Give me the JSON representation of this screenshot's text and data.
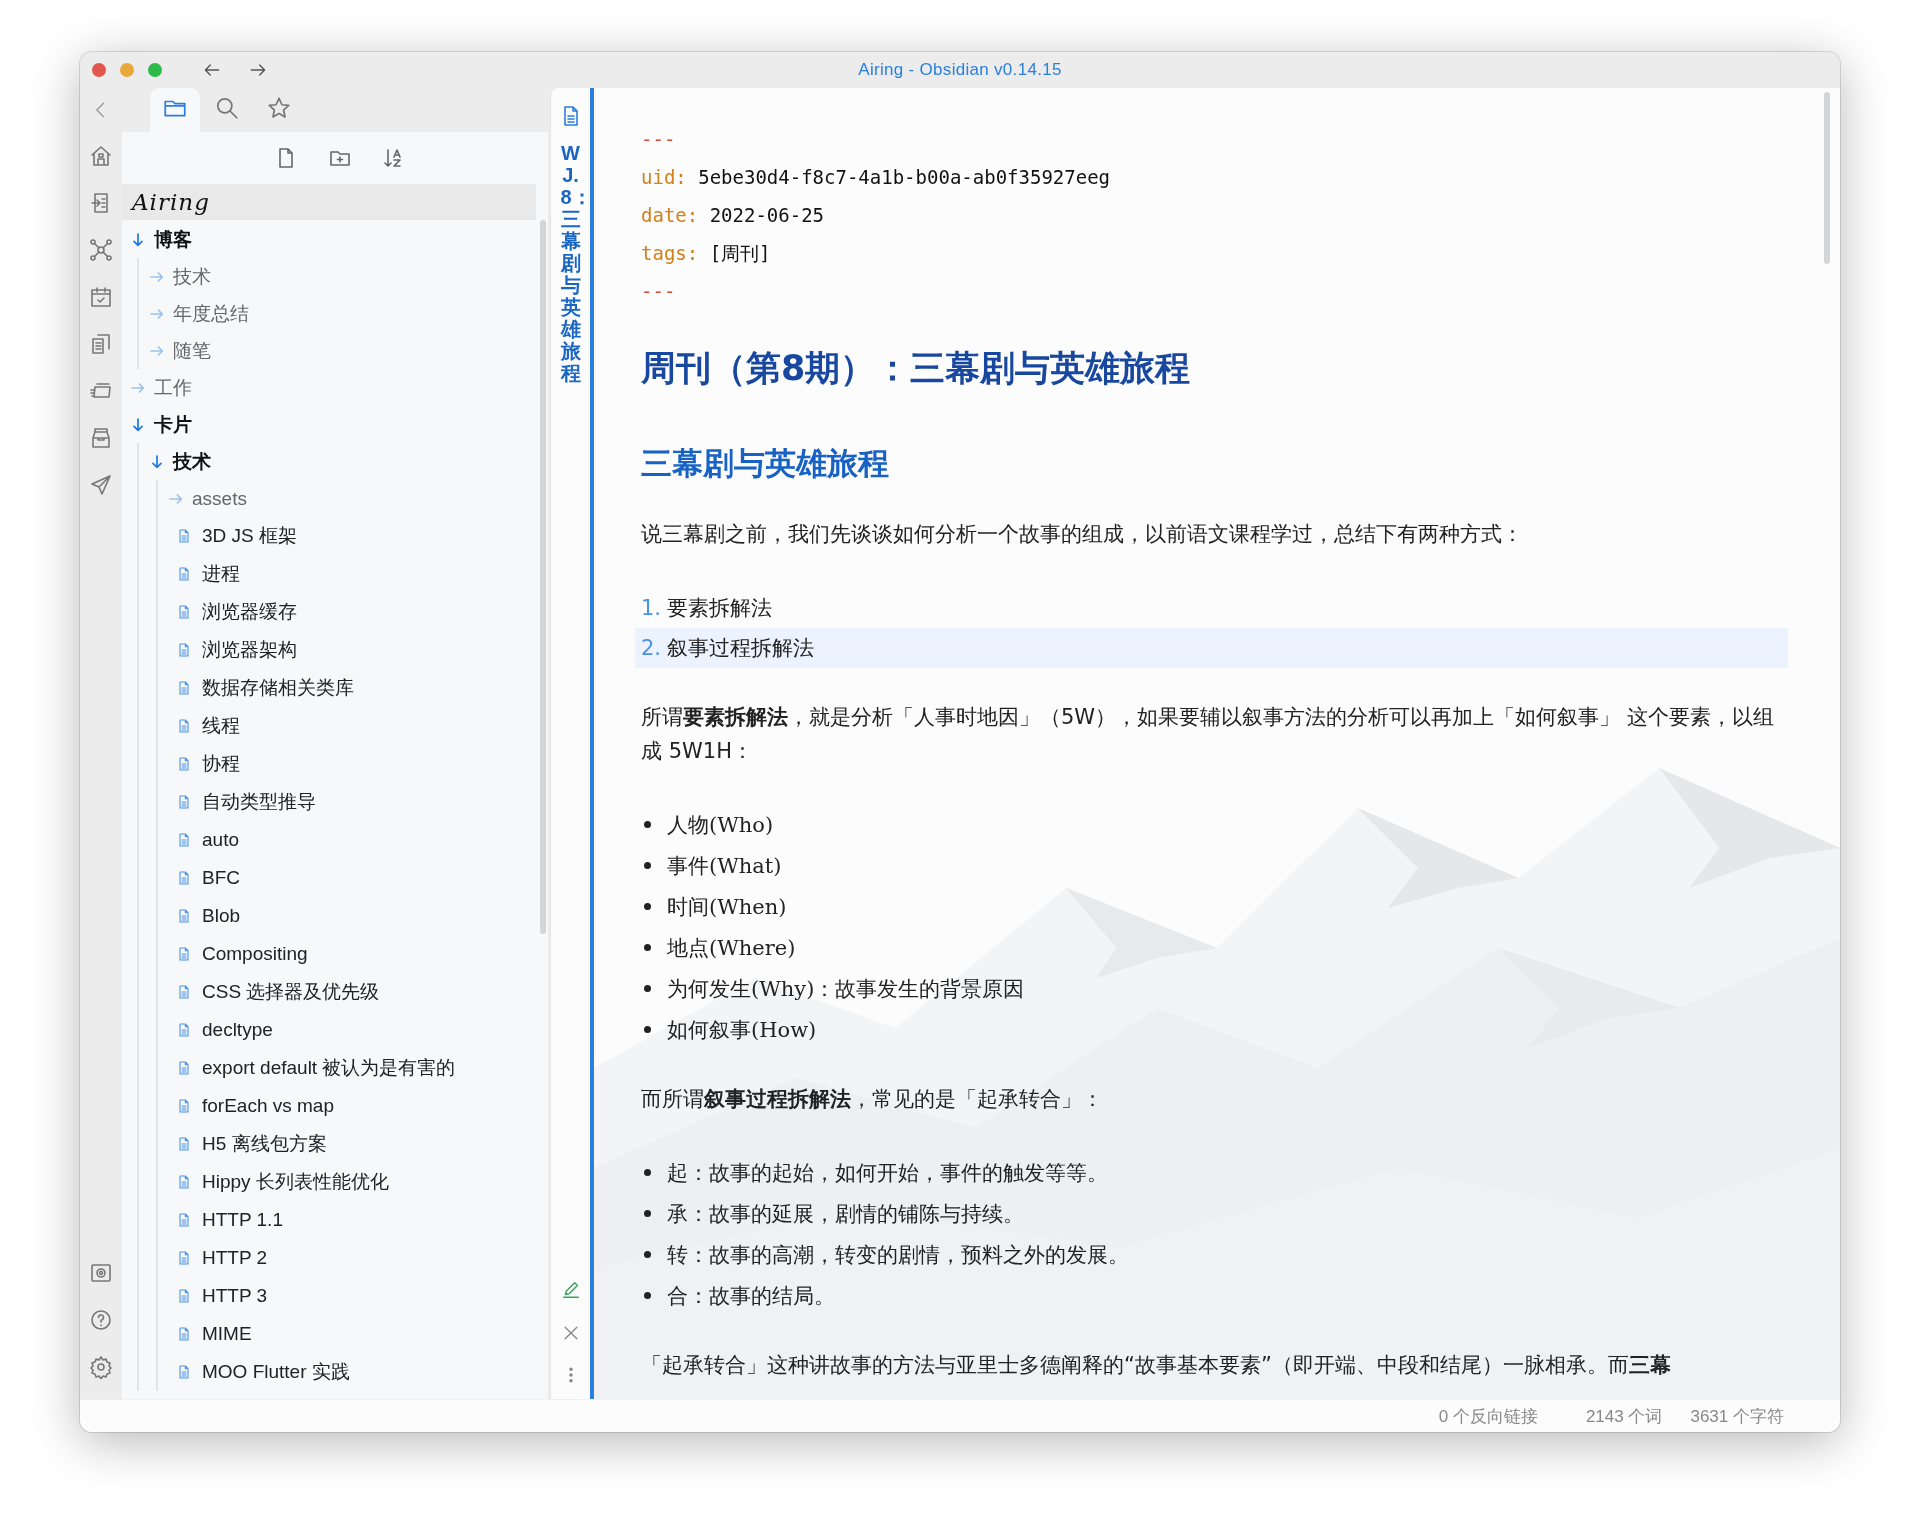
{
  "window": {
    "title": "Airing - Obsidian v0.14.15"
  },
  "sidebar_tabs": [
    {
      "selected": true
    },
    {
      "selected": false
    },
    {
      "selected": false
    }
  ],
  "vault_name": "Airing",
  "tree": [
    {
      "kind": "folder",
      "name": "博客",
      "expanded": true,
      "children": [
        {
          "kind": "folder",
          "name": "技术",
          "expanded": false
        },
        {
          "kind": "folder",
          "name": "年度总结",
          "expanded": false
        },
        {
          "kind": "folder",
          "name": "随笔",
          "expanded": false
        }
      ]
    },
    {
      "kind": "folder",
      "name": "工作",
      "expanded": false
    },
    {
      "kind": "folder",
      "name": "卡片",
      "expanded": true,
      "children": [
        {
          "kind": "folder",
          "name": "技术",
          "expanded": true,
          "children": [
            {
              "kind": "folder",
              "name": "assets",
              "expanded": false
            },
            {
              "kind": "file",
              "name": "3D JS 框架"
            },
            {
              "kind": "file",
              "name": "进程"
            },
            {
              "kind": "file",
              "name": "浏览器缓存"
            },
            {
              "kind": "file",
              "name": "浏览器架构"
            },
            {
              "kind": "file",
              "name": "数据存储相关类库"
            },
            {
              "kind": "file",
              "name": "线程"
            },
            {
              "kind": "file",
              "name": "协程"
            },
            {
              "kind": "file",
              "name": "自动类型推导"
            },
            {
              "kind": "file",
              "name": "auto"
            },
            {
              "kind": "file",
              "name": "BFC"
            },
            {
              "kind": "file",
              "name": "Blob"
            },
            {
              "kind": "file",
              "name": "Compositing"
            },
            {
              "kind": "file",
              "name": "CSS 选择器及优先级"
            },
            {
              "kind": "file",
              "name": "decltype"
            },
            {
              "kind": "file",
              "name": "export default 被认为是有害的"
            },
            {
              "kind": "file",
              "name": "forEach vs map"
            },
            {
              "kind": "file",
              "name": "H5 离线包方案"
            },
            {
              "kind": "file",
              "name": "Hippy 长列表性能优化"
            },
            {
              "kind": "file",
              "name": "HTTP 1.1"
            },
            {
              "kind": "file",
              "name": "HTTP 2"
            },
            {
              "kind": "file",
              "name": "HTTP 3"
            },
            {
              "kind": "file",
              "name": "MIME"
            },
            {
              "kind": "file",
              "name": "MOO Flutter 实践"
            }
          ]
        }
      ]
    }
  ],
  "open_tab": {
    "title": "WJ.8：三幕剧与英雄旅程"
  },
  "editor": {
    "frontmatter_open": "---",
    "frontmatter": [
      {
        "key": "uid:",
        "value": "5ebe30d4-f8c7-4a1b-b00a-ab0f35927eeg"
      },
      {
        "key": "date:",
        "value": "2022-06-25"
      },
      {
        "key": "tags:",
        "value": "[周刊]"
      }
    ],
    "frontmatter_close": "---",
    "blocks": [
      {
        "kind": "h1",
        "text": "周刊（第8期）：三幕剧与英雄旅程"
      },
      {
        "kind": "h2",
        "text": "三幕剧与英雄旅程"
      },
      {
        "kind": "paragraph",
        "text": "说三幕剧之前，我们先谈谈如何分析一个故事的组成，以前语文课程学过，总结下有两种方式："
      },
      {
        "kind": "ol",
        "items": [
          {
            "number": "1.",
            "text": "要素拆解法",
            "highlighted": false
          },
          {
            "number": "2.",
            "text": "叙事过程拆解法",
            "highlighted": true
          }
        ]
      },
      {
        "kind": "paragraph",
        "text": "所谓**要素拆解法**，就是分析「人事时地因」（5W），如果要辅以叙事方法的分析可以再加上「如何叙事」 这个要素，以组成 5W1H："
      },
      {
        "kind": "ul",
        "items": [
          {
            "text": "人物(Who)"
          },
          {
            "text": "事件(What)"
          },
          {
            "text": "时间(When)"
          },
          {
            "text": "地点(Where)"
          },
          {
            "text": "为何发生(Why)：故事发生的背景原因"
          },
          {
            "text": "如何叙事(How)"
          }
        ]
      },
      {
        "kind": "paragraph",
        "text": "而所谓**叙事过程拆解法**，常见的是「起承转合」："
      },
      {
        "kind": "ul",
        "items": [
          {
            "text": "起：故事的起始，如何开始，事件的触发等等。"
          },
          {
            "text": "承：故事的延展，剧情的铺陈与持续。"
          },
          {
            "text": "转：故事的高潮，转变的剧情，预料之外的发展。"
          },
          {
            "text": "合：故事的结局。"
          }
        ]
      },
      {
        "kind": "paragraph",
        "text": "「起承转合」这种讲故事的方法与亚里士多德阐释的“故事基本要素”（即开端、中段和结尾）一脉相承。而**三幕**"
      }
    ]
  },
  "status_bar": [
    "0 个反向链接",
    "2143 个词",
    "3631 个字符"
  ]
}
